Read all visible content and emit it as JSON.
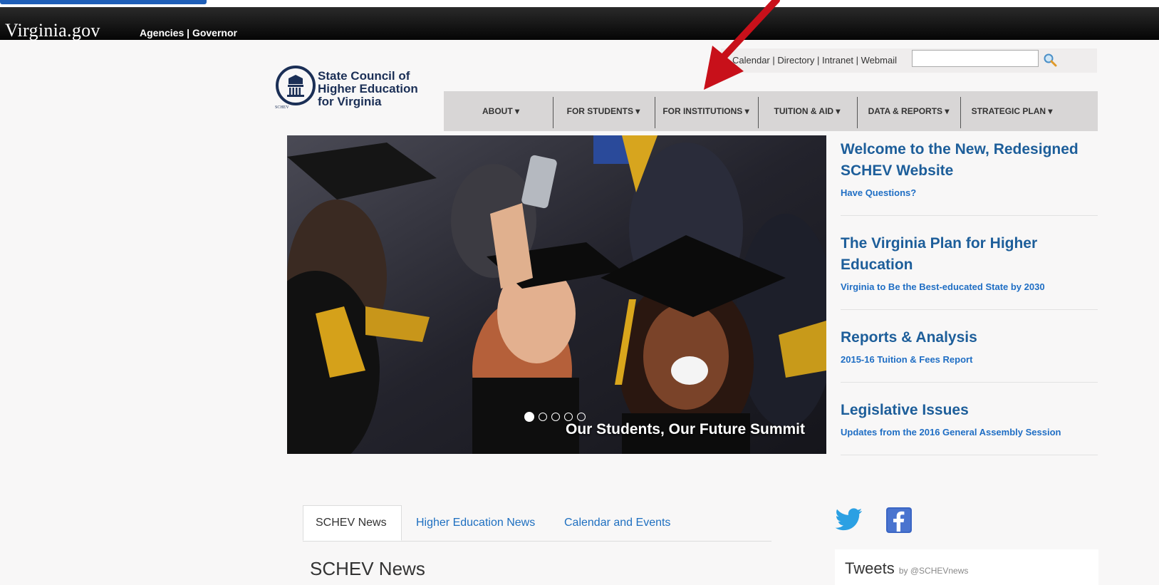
{
  "gov_header": {
    "logo_text": "Virginia.gov",
    "links": [
      "Agencies",
      "Governor"
    ],
    "separator": "|"
  },
  "logo": {
    "line1": "State Council of",
    "line2": "Higher Education",
    "line3": "for Virginia",
    "seal_text": "SCHEV"
  },
  "utility": {
    "links_text": "Calendar | Directory | Intranet | Webmail",
    "search_value": ""
  },
  "nav": {
    "items": [
      "ABOUT ▾",
      "FOR STUDENTS ▾",
      "FOR INSTITUTIONS ▾",
      "TUITION & AID ▾",
      "DATA & REPORTS ▾",
      "STRATEGIC PLAN ▾"
    ]
  },
  "hero": {
    "caption": "Our Students, Our Future Summit",
    "slide_count": 5,
    "active_slide": 1
  },
  "features": [
    {
      "title": "Welcome to the New, Redesigned SCHEV Website",
      "link": "Have Questions?"
    },
    {
      "title": "The Virginia Plan for Higher Education",
      "link": "Virginia to Be the Best-educated State by 2030"
    },
    {
      "title": "Reports & Analysis",
      "link": "2015-16 Tuition & Fees Report"
    },
    {
      "title": "Legislative Issues",
      "link": "Updates from the 2016 General Assembly Session"
    }
  ],
  "news_tabs": {
    "tabs": [
      "SCHEV News",
      "Higher Education News",
      "Calendar and Events"
    ],
    "active": 0,
    "section_title": "SCHEV News"
  },
  "social": {
    "icons": [
      "twitter-icon",
      "facebook-icon"
    ]
  },
  "tweets": {
    "title": "Tweets",
    "by": "by",
    "handle": "@SCHEVnews"
  },
  "colors": {
    "link_blue": "#1d5e9a",
    "nav_bg": "#d8d6d6",
    "annotation_red": "#c8101a"
  }
}
